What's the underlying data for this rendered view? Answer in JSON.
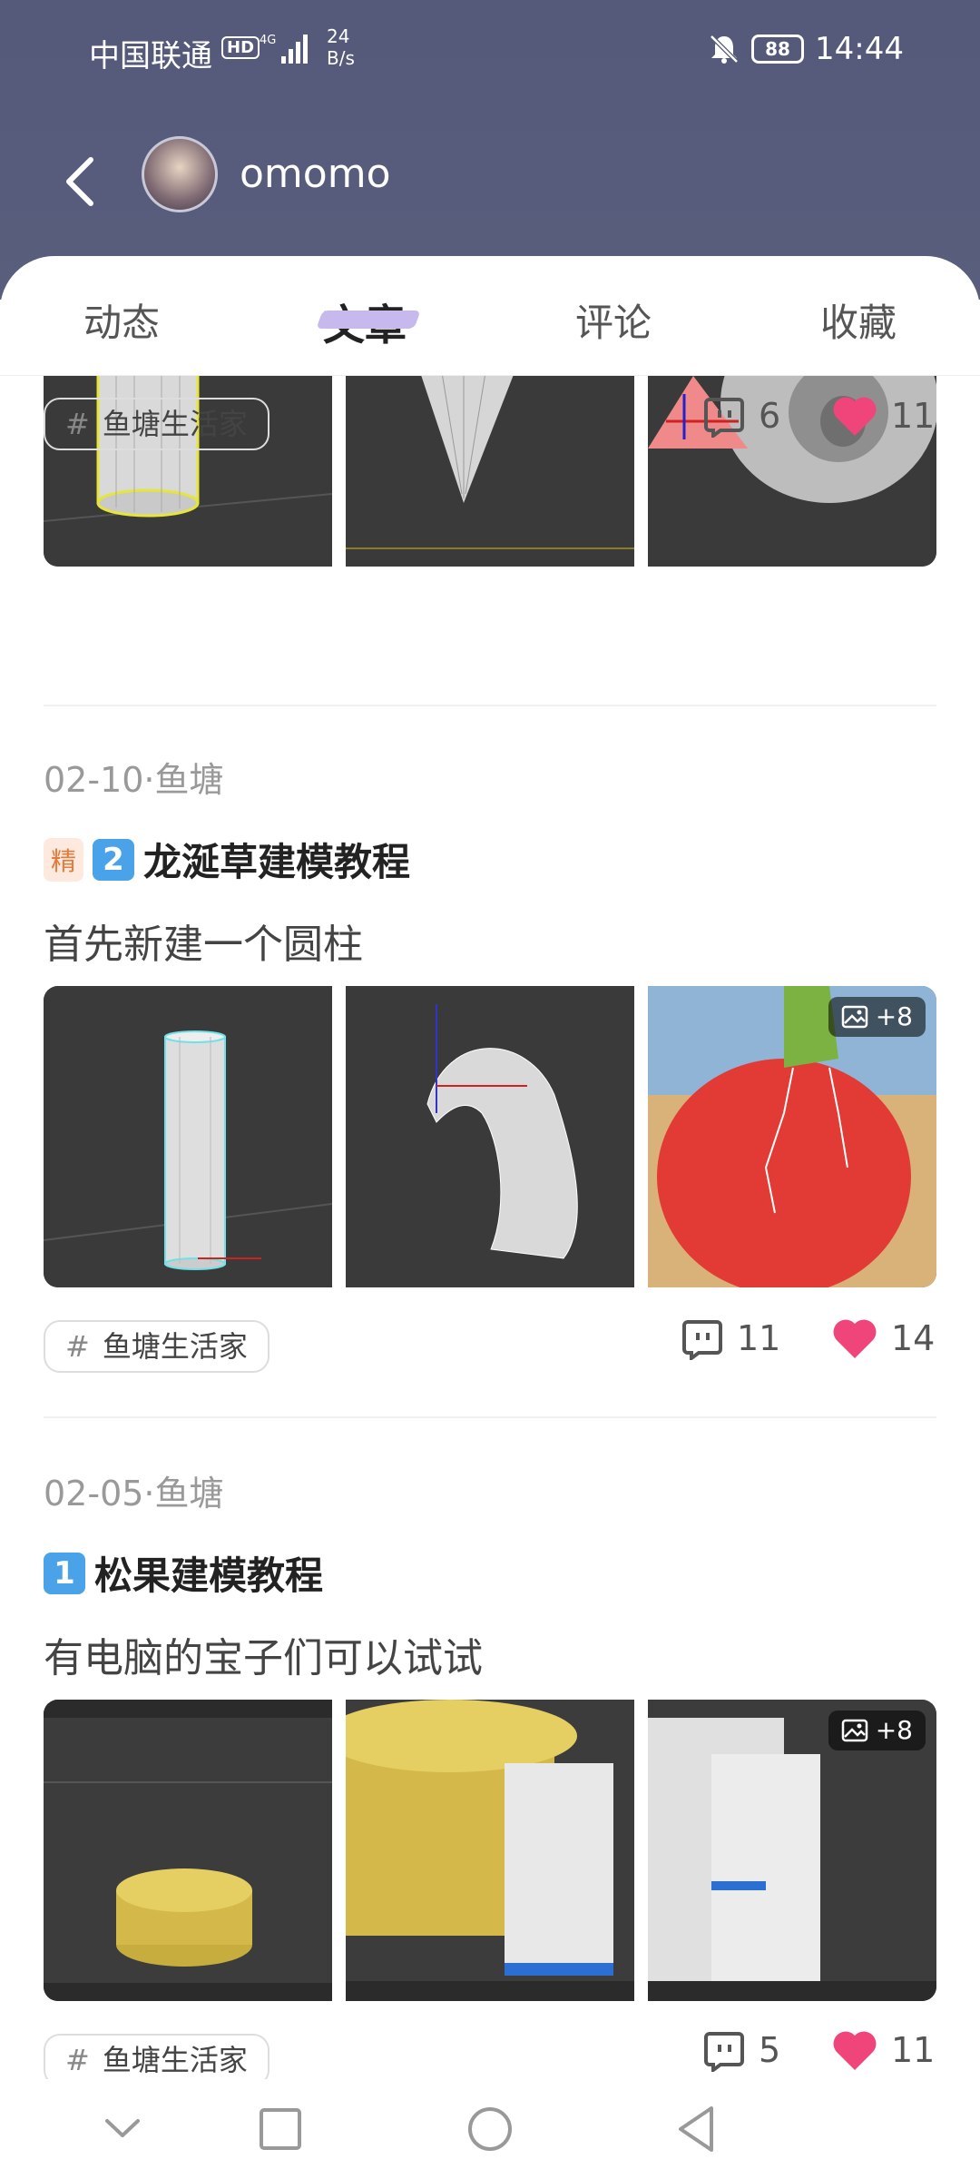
{
  "status_bar": {
    "carrier": "中国联通",
    "hd": "HD",
    "network": "4G",
    "speed_value": "24",
    "speed_unit": "B/s",
    "battery": "88",
    "time": "14:44"
  },
  "profile": {
    "username": "omomo"
  },
  "tabs": [
    "动态",
    "文章",
    "评论",
    "收藏"
  ],
  "active_tab": "文章",
  "posts": [
    {
      "tag": "鱼塘生活家",
      "comments": "6",
      "likes": "11"
    },
    {
      "date": "02-10",
      "separator": "·",
      "category": "鱼塘",
      "featured": "精",
      "number": "2",
      "title": "龙涎草建模教程",
      "subtitle": "首先新建一个圆柱",
      "more_images": "+8",
      "tag": "鱼塘生活家",
      "comments": "11",
      "likes": "14"
    },
    {
      "date": "02-05",
      "separator": "·",
      "category": "鱼塘",
      "number": "1",
      "title": "松果建模教程",
      "subtitle": "有电脑的宝子们可以试试",
      "more_images": "+8",
      "tag": "鱼塘生活家",
      "comments": "5",
      "likes": "11"
    }
  ],
  "tag_symbol": "#",
  "colors": {
    "header": "#55597a",
    "like": "#f0457a",
    "tab_highlight": "#c7b8ee"
  }
}
